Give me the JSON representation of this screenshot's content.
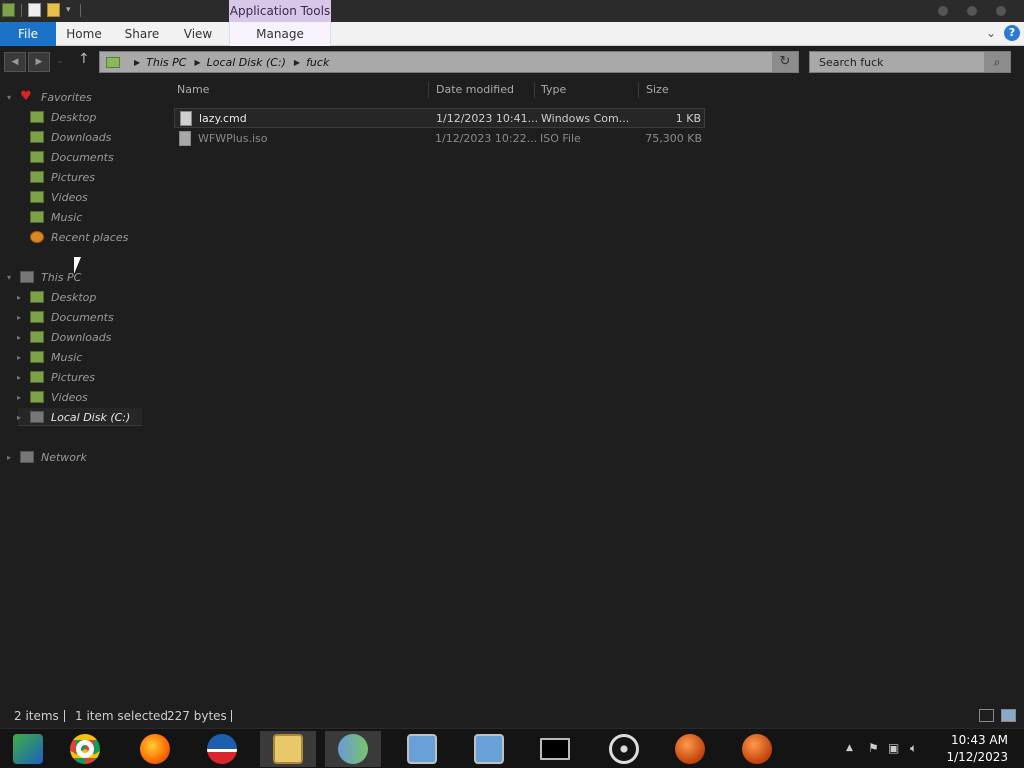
{
  "titlebar": {
    "application_tools": "Application Tools"
  },
  "ribbon": {
    "tabs": [
      "File",
      "Home",
      "Share",
      "View",
      "Manage"
    ]
  },
  "address": {
    "crumbs": [
      "This PC",
      "Local Disk (C:)",
      "fuck"
    ],
    "search_placeholder": "Search fuck"
  },
  "navigation": {
    "favorites_label": "Favorites",
    "favorites": [
      "Desktop",
      "Downloads",
      "Documents",
      "Pictures",
      "Videos",
      "Music",
      "Recent places"
    ],
    "thispc_label": "This PC",
    "thispc": [
      "Desktop",
      "Documents",
      "Downloads",
      "Music",
      "Pictures",
      "Videos",
      "Local Disk (C:)"
    ],
    "network_label": "Network"
  },
  "filelist": {
    "columns": [
      "Name",
      "Date modified",
      "Type",
      "Size"
    ],
    "rows": [
      {
        "name": "lazy.cmd",
        "date": "1/12/2023 10:41...",
        "type": "Windows Com...",
        "size": "1 KB",
        "selected": true
      },
      {
        "name": "WFWPlus.iso",
        "date": "1/12/2023 10:22...",
        "type": "ISO File",
        "size": "75,300 KB",
        "selected": false
      }
    ]
  },
  "statusbar": {
    "items_count": "2 items",
    "selection": "1 item selected",
    "selection_size": "227 bytes"
  },
  "taskbar": {
    "apps": [
      "media-player",
      "chrome",
      "firefox",
      "campaign-app",
      "file-explorer",
      "users-app",
      "network-setup-1",
      "network-setup-2",
      "command-prompt",
      "disc-utility",
      "browser-orange-1",
      "browser-orange-2"
    ],
    "time": "10:43 AM",
    "date": "1/12/2023"
  },
  "colors": {
    "file_tab": "#1a73c8",
    "application_tools": "#d8c8e8",
    "background": "#1e1e1e"
  }
}
